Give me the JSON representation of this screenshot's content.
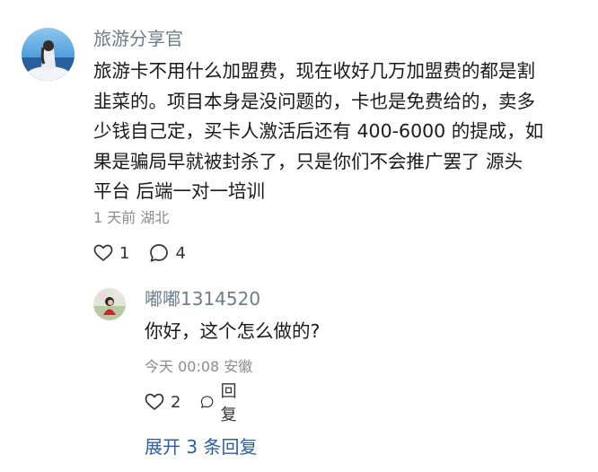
{
  "comment": {
    "username": "旅游分享官",
    "lines": [
      "旅游卡不用什么加盟费，现在收好几万加盟费的都是割",
      "韭菜的。项目本身是没问题的，卡也是免费给的，卖多",
      "少钱自己定，买卡人激活后还有 400-6000 的提成，如",
      "果是骗局早就被封杀了，只是你们不会推广罢了 源头",
      "平台 后端一对一培训"
    ],
    "meta": "1 天前 湖北",
    "like_count": "1",
    "reply_count": "4",
    "icons": {
      "like": "heart-outline-icon",
      "comment": "speech-bubble-icon"
    }
  },
  "reply": {
    "username": "嘟嘟1314520",
    "text": "你好，这个怎么做的?",
    "meta": "今天 00:08 安徽",
    "like_count": "2",
    "reply_label": "回复"
  },
  "expand_label": "展开 3 条回复",
  "colors": {
    "username": "#6e7c8a",
    "body": "#1a1a1a",
    "meta": "#8c8c8c",
    "link": "#2a5db0"
  }
}
